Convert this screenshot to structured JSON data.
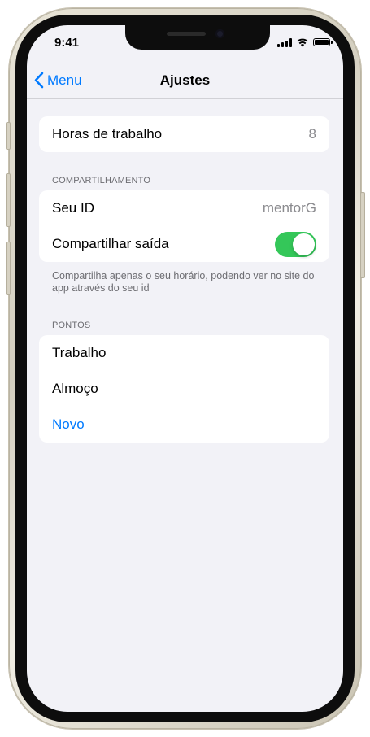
{
  "status_bar": {
    "time": "9:41",
    "icons": [
      "cellular-signal-icon",
      "wifi-icon",
      "battery-icon"
    ]
  },
  "nav": {
    "back_label": "Menu",
    "title": "Ajustes"
  },
  "work_hours": {
    "label": "Horas de trabalho",
    "value": "8"
  },
  "sharing": {
    "header": "COMPARTILHAMENTO",
    "id_label": "Seu ID",
    "id_value": "mentorG",
    "share_label": "Compartilhar saída",
    "share_enabled": true,
    "footer": "Compartilha apenas o seu horário, podendo ver no site do app através do seu id"
  },
  "points": {
    "header": "PONTOS",
    "items": [
      "Trabalho",
      "Almoço"
    ],
    "new_label": "Novo"
  },
  "colors": {
    "accent": "#007aff",
    "toggle_on": "#34c759",
    "background": "#f2f2f7"
  }
}
